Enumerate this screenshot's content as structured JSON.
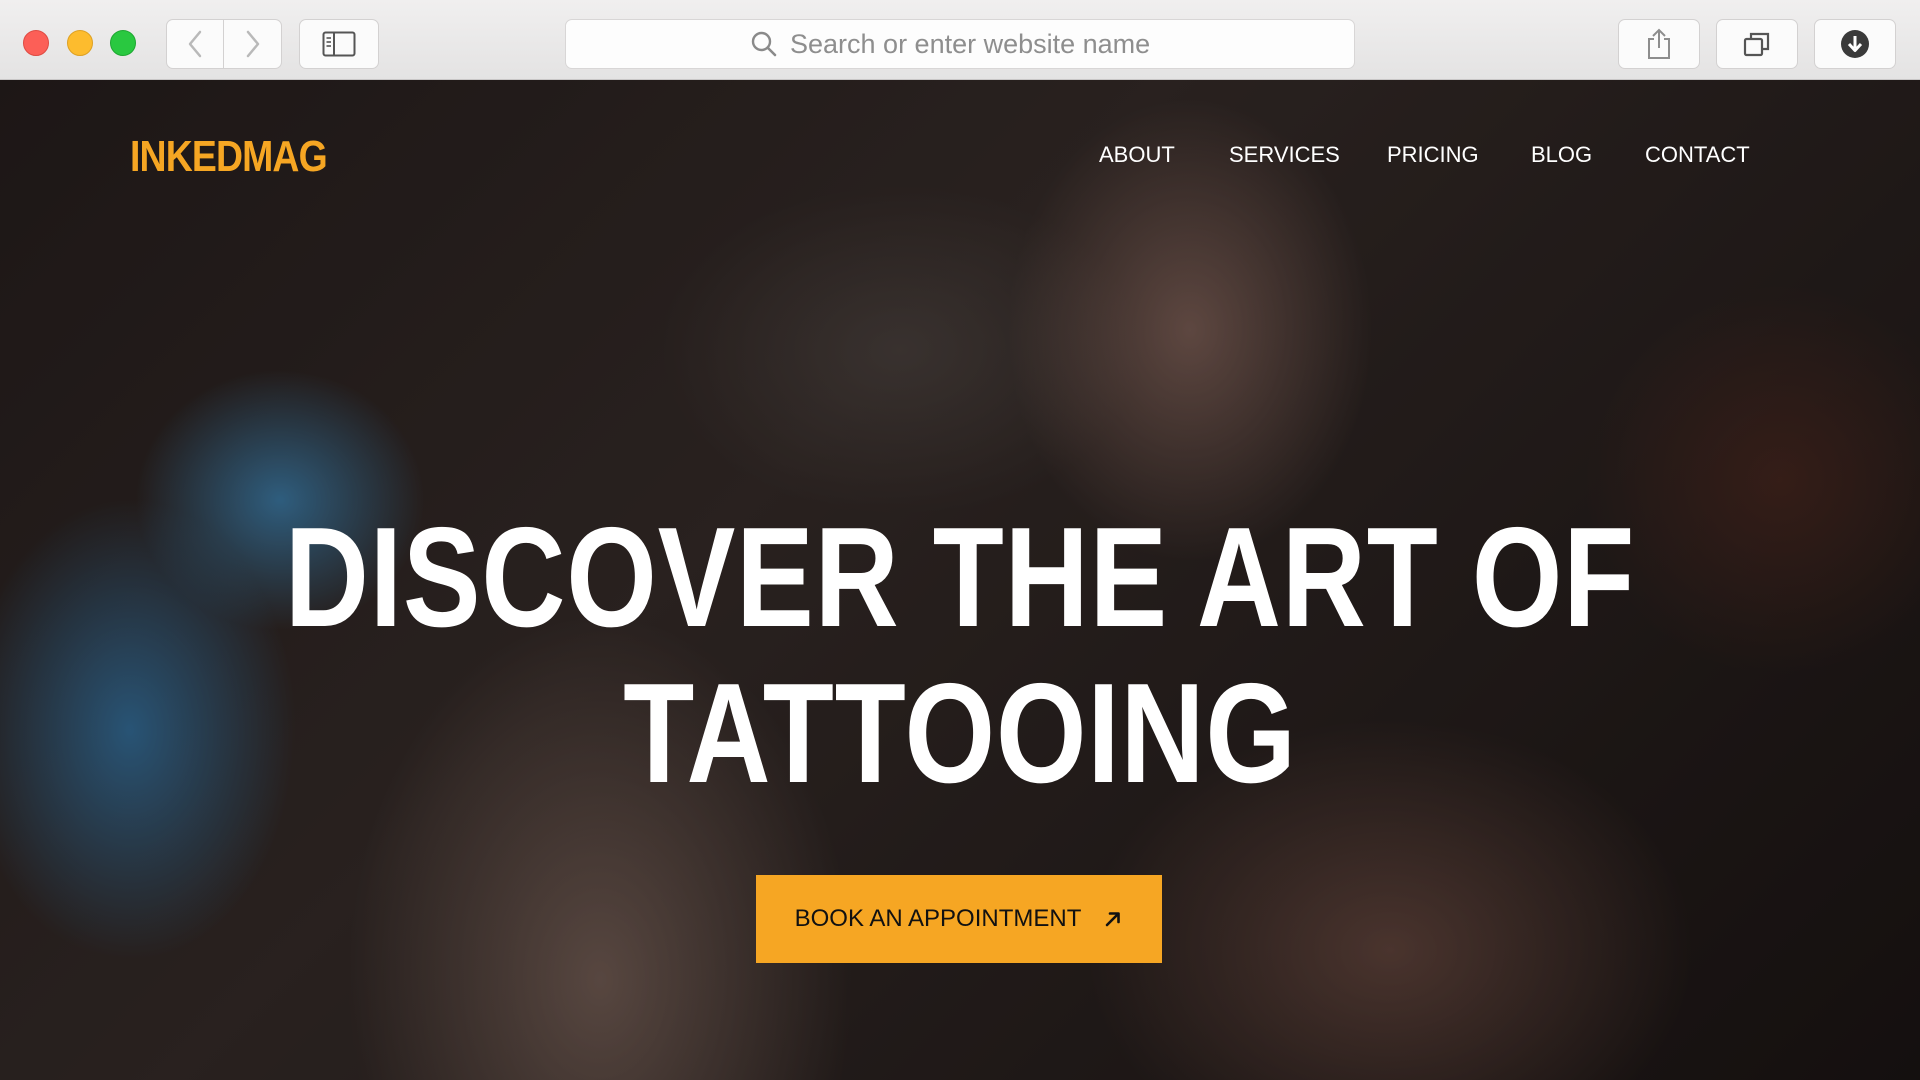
{
  "browser": {
    "address_placeholder": "Search or enter website name",
    "icons": {
      "back": "chevron-left-icon",
      "forward": "chevron-right-icon",
      "sidebar": "sidebar-icon",
      "search": "search-icon",
      "share": "share-icon",
      "tabs": "tabs-icon",
      "download": "download-icon"
    }
  },
  "site": {
    "logo": "INKEDMAG",
    "nav": {
      "about": "ABOUT",
      "services": "SERVICES",
      "pricing": "PRICING",
      "blog": "BLOG",
      "contact": "CONTACT"
    },
    "hero": {
      "line1": "DISCOVER THE ART OF",
      "line2": "TATTOOING",
      "cta_label": "BOOK AN APPOINTMENT",
      "cta_icon": "arrow-up-right-icon"
    }
  },
  "colors": {
    "accent": "#f6a623",
    "headline": "#ffffff"
  }
}
